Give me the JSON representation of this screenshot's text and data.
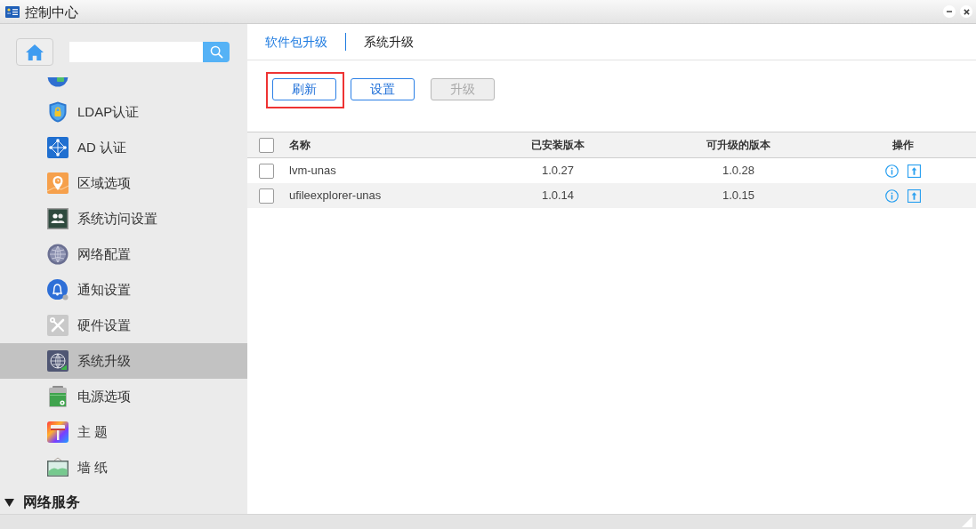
{
  "window": {
    "title": "控制中心"
  },
  "sidebar": {
    "items": [
      {
        "label": "LDAP认证",
        "selected": false
      },
      {
        "label": "AD 认证",
        "selected": false
      },
      {
        "label": "区域选项",
        "selected": false
      },
      {
        "label": "系统访问设置",
        "selected": false
      },
      {
        "label": "网络配置",
        "selected": false
      },
      {
        "label": "通知设置",
        "selected": false
      },
      {
        "label": "硬件设置",
        "selected": false
      },
      {
        "label": "系统升级",
        "selected": true
      },
      {
        "label": "电源选项",
        "selected": false
      },
      {
        "label": "主 题",
        "selected": false
      },
      {
        "label": "墙 纸",
        "selected": false
      }
    ],
    "section": {
      "label": "网络服务",
      "expanded": true
    }
  },
  "tabs": [
    {
      "label": "软件包升级",
      "selected": true
    },
    {
      "label": "系统升级",
      "selected": false
    }
  ],
  "toolbar": {
    "buttons": [
      {
        "label": "刷新",
        "disabled": false,
        "highlighted": true
      },
      {
        "label": "设置",
        "disabled": false,
        "highlighted": false
      },
      {
        "label": "升级",
        "disabled": true,
        "highlighted": false
      }
    ]
  },
  "table": {
    "select_all": {
      "checked": false
    },
    "columns": [
      "名称",
      "已安装版本",
      "可升级的版本",
      "操作"
    ],
    "rows": [
      {
        "checked": false,
        "name": "lvm-unas",
        "installed": "1.0.27",
        "available": "1.0.28"
      },
      {
        "checked": false,
        "name": "ufileexplorer-unas",
        "installed": "1.0.14",
        "available": "1.0.15"
      }
    ]
  }
}
